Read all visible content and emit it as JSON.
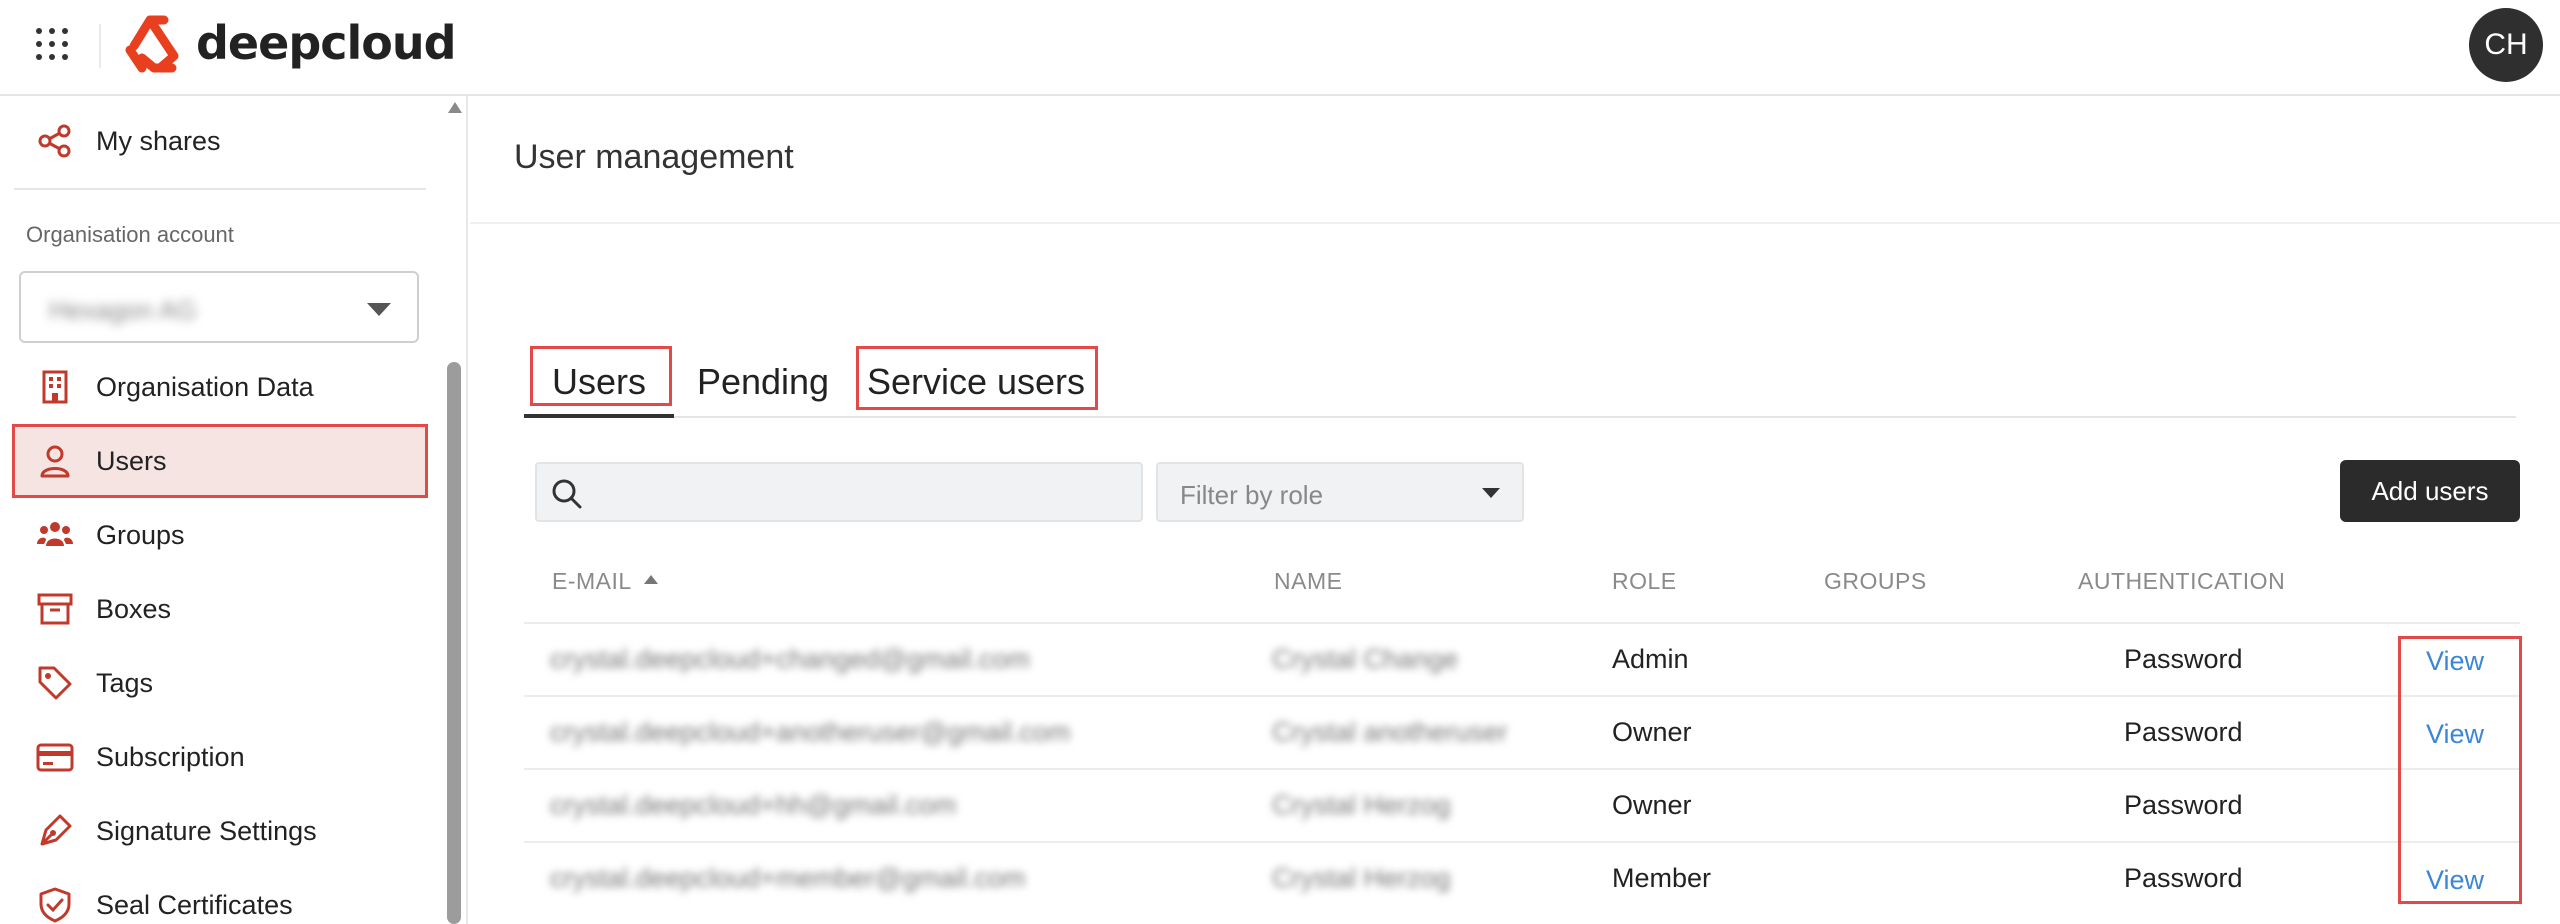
{
  "header": {
    "brand": "deepcloud",
    "avatar_initials": "CH",
    "brand_color": "#e8401f"
  },
  "sidebar": {
    "top_item": {
      "label": "My shares",
      "icon": "share-icon"
    },
    "section_label": "Organisation account",
    "org_select": {
      "value": "Hexagon AG"
    },
    "items": [
      {
        "label": "Organisation Data",
        "icon": "building-icon"
      },
      {
        "label": "Users",
        "icon": "user-icon",
        "active": true
      },
      {
        "label": "Groups",
        "icon": "group-icon"
      },
      {
        "label": "Boxes",
        "icon": "archive-box-icon"
      },
      {
        "label": "Tags",
        "icon": "tag-icon"
      },
      {
        "label": "Subscription",
        "icon": "credit-card-icon"
      },
      {
        "label": "Signature Settings",
        "icon": "pen-nib-icon"
      },
      {
        "label": "Seal Certificates",
        "icon": "shield-check-icon"
      }
    ]
  },
  "main": {
    "title": "User management",
    "tabs": [
      {
        "label": "Users",
        "active": true
      },
      {
        "label": "Pending"
      },
      {
        "label": "Service users"
      }
    ],
    "search": {
      "placeholder": ""
    },
    "filter": {
      "placeholder": "Filter by role"
    },
    "add_button": "Add users",
    "table": {
      "columns": [
        "E-MAIL",
        "NAME",
        "ROLE",
        "GROUPS",
        "AUTHENTICATION"
      ],
      "sort_column": "E-MAIL",
      "rows": [
        {
          "email": "crystal.deepcloud+changed@gmail.com",
          "name": "Crystal Change",
          "role": "Admin",
          "groups": "",
          "auth": "Password",
          "action": "View"
        },
        {
          "email": "crystal.deepcloud+anotheruser@gmail.com",
          "name": "Crystal anotheruser",
          "role": "Owner",
          "groups": "",
          "auth": "Password",
          "action": "View"
        },
        {
          "email": "crystal.deepcloud+hh@gmail.com",
          "name": "Crystal Herzog",
          "role": "Owner",
          "groups": "",
          "auth": "Password",
          "action": ""
        },
        {
          "email": "crystal.deepcloud+member@gmail.com",
          "name": "Crystal Herzog",
          "role": "Member",
          "groups": "",
          "auth": "Password",
          "action": "View"
        }
      ]
    }
  },
  "colors": {
    "accent_icon": "#c0392b",
    "highlight_border": "#e24a4a",
    "active_bg": "#f6e4e2",
    "link": "#3b86d6",
    "button_bg": "#2b2b2b"
  }
}
